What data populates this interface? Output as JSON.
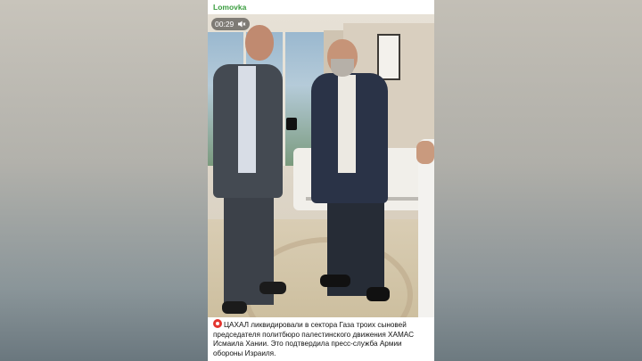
{
  "channel": {
    "name": "Lomovka"
  },
  "video": {
    "timestamp": "00:29",
    "mute_icon": "speaker-muted-icon"
  },
  "caption": {
    "text": "ЦАХАЛ ликвидировали в сектора Газа троих сыновей председателя политбюро палестинского движения ХАМАС Исмаила Хании. Это подтвердила пресс-служба Армии обороны Израиля.",
    "icon": "siren-icon"
  },
  "colors": {
    "channel_name": "#3a9d3f",
    "caption_icon": "#e3352f"
  }
}
